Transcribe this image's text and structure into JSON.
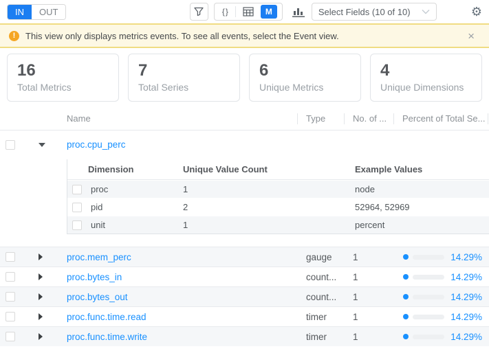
{
  "colors": {
    "accent_blue": "#1b7ef2",
    "link_blue": "#1890ff",
    "banner_bg": "#fdf8e4",
    "banner_border": "#f0dc82",
    "warning_orange": "#f5a623",
    "row_shade": "#f5f7f9"
  },
  "toolbar": {
    "segmented": {
      "in": "IN",
      "out": "OUT"
    },
    "braces_icon": "{}",
    "m_button": "M",
    "select_fields_label": "Select Fields (10 of 10)",
    "gear_icon": "⚙"
  },
  "banner": {
    "icon_mark": "!",
    "message": "This view only displays metrics events. To see all events, select the Event view.",
    "close": "×"
  },
  "stats": [
    {
      "value": "16",
      "label": "Total Metrics"
    },
    {
      "value": "7",
      "label": "Total Series"
    },
    {
      "value": "6",
      "label": "Unique Metrics"
    },
    {
      "value": "4",
      "label": "Unique Dimensions"
    }
  ],
  "table": {
    "headers": {
      "name": "Name",
      "type": "Type",
      "no_of": "No. of ...",
      "percent": "Percent of Total Se..."
    },
    "expanded_row": {
      "name": "proc.cpu_perc",
      "dimensions_table": {
        "headers": {
          "dimension": "Dimension",
          "unique_value_count": "Unique Value Count",
          "example_values": "Example Values"
        },
        "rows": [
          {
            "dimension": "proc",
            "count": "1",
            "examples": "node"
          },
          {
            "dimension": "pid",
            "count": "2",
            "examples": "52964, 52969"
          },
          {
            "dimension": "unit",
            "count": "1",
            "examples": "percent"
          }
        ]
      }
    },
    "rows": [
      {
        "name": "proc.mem_perc",
        "type": "gauge",
        "no_of": "1",
        "percent": "14.29%"
      },
      {
        "name": "proc.bytes_in",
        "type": "count...",
        "no_of": "1",
        "percent": "14.29%"
      },
      {
        "name": "proc.bytes_out",
        "type": "count...",
        "no_of": "1",
        "percent": "14.29%"
      },
      {
        "name": "proc.func.time.read",
        "type": "timer",
        "no_of": "1",
        "percent": "14.29%"
      },
      {
        "name": "proc.func.time.write",
        "type": "timer",
        "no_of": "1",
        "percent": "14.29%"
      }
    ]
  }
}
